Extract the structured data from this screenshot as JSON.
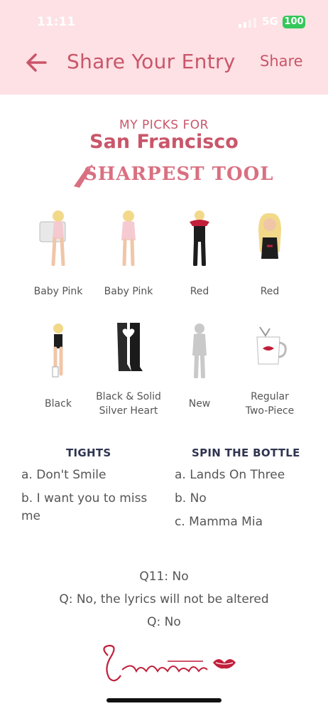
{
  "status": {
    "time": "11:11",
    "network": "5G",
    "battery": "100"
  },
  "header": {
    "title": "Share Your Entry",
    "share_label": "Share"
  },
  "picks": {
    "kicker": "MY PICKS FOR",
    "city": "San Francisco",
    "tour_logo": "SHARPEST TOOL",
    "items": [
      {
        "label": "Baby Pink"
      },
      {
        "label": "Baby Pink"
      },
      {
        "label": "Red"
      },
      {
        "label": "Red"
      },
      {
        "label": "Black"
      },
      {
        "label": "Black & Solid\nSilver Heart"
      },
      {
        "label": "New"
      },
      {
        "label": "Regular\nTwo-Piece"
      }
    ]
  },
  "columns": {
    "left": {
      "heading": "TIGHTS",
      "answers": [
        "a. Don't Smile",
        "b. I want you to miss me"
      ]
    },
    "right": {
      "heading": "SPIN THE BOTTLE",
      "answers": [
        "a. Lands On Three",
        "b. No",
        "c. Mamma Mia"
      ]
    }
  },
  "footer": {
    "q11": "Q11: No",
    "q_lyrics": "Q: No, the lyrics will not be altered",
    "q_last": "Q: No",
    "signature": "Sabrinalert"
  },
  "colors": {
    "header_bg": "#fde1e4",
    "accent": "#c9566a",
    "heading_dark": "#2f3550"
  }
}
